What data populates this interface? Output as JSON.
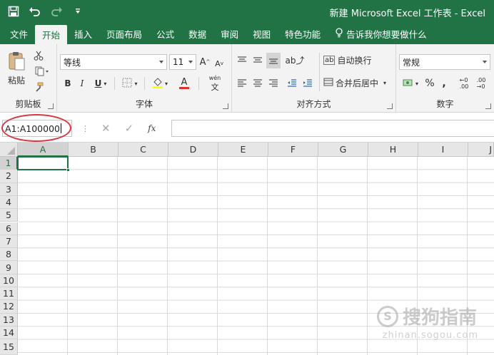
{
  "window": {
    "title": "新建 Microsoft Excel 工作表 - Excel"
  },
  "tabs": [
    {
      "label": "文件"
    },
    {
      "label": "开始"
    },
    {
      "label": "插入"
    },
    {
      "label": "页面布局"
    },
    {
      "label": "公式"
    },
    {
      "label": "数据"
    },
    {
      "label": "审阅"
    },
    {
      "label": "视图"
    },
    {
      "label": "特色功能"
    },
    {
      "label": "告诉我你想要做什么"
    }
  ],
  "ribbon": {
    "clipboard": {
      "label": "剪贴板",
      "paste": "粘贴"
    },
    "font": {
      "label": "字体",
      "name": "等线",
      "size": "11",
      "bold": "B",
      "italic": "I",
      "underline": "U",
      "grow": "A",
      "shrink": "A",
      "color": "A",
      "wen": "wén"
    },
    "align": {
      "label": "对齐方式",
      "wrap": "自动换行",
      "merge": "合并后居中"
    },
    "number": {
      "label": "数字",
      "format": "常规",
      "percent": "%",
      "comma": ","
    }
  },
  "formula_bar": {
    "name_box": "A1:A100000",
    "fx": "fx",
    "formula": ""
  },
  "columns": [
    "A",
    "B",
    "C",
    "D",
    "E",
    "F",
    "G",
    "H",
    "I",
    "J"
  ],
  "rows": [
    "1",
    "2",
    "3",
    "4",
    "5",
    "6",
    "7",
    "8",
    "9",
    "10",
    "11",
    "12",
    "13",
    "14",
    "15"
  ],
  "watermark": {
    "brand": "搜狗指南",
    "url": "zhinan.sogou.com"
  },
  "colors": {
    "accent": "#217346",
    "highlight": "#d9363e"
  }
}
